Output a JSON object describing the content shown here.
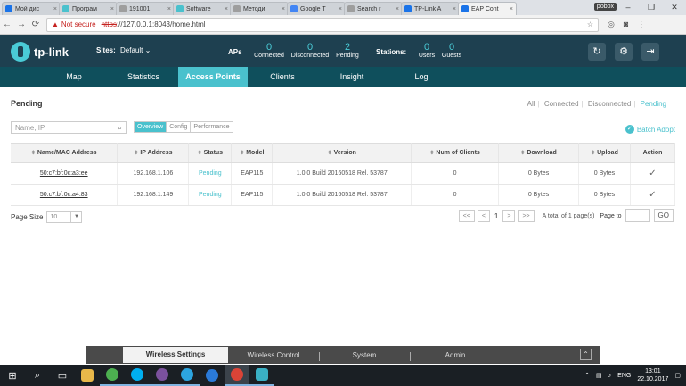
{
  "browser": {
    "tabs": [
      {
        "title": "Мой дис",
        "color": "#1a73e8",
        "active": false
      },
      {
        "title": "Програм",
        "color": "#4ac1cd",
        "active": false
      },
      {
        "title": "191001",
        "color": "#9e9e9e",
        "active": false
      },
      {
        "title": "Software",
        "color": "#4ac1cd",
        "active": false
      },
      {
        "title": "Методи",
        "color": "#9e9e9e",
        "active": false
      },
      {
        "title": "Google T",
        "color": "#4285f4",
        "active": false
      },
      {
        "title": "Search r",
        "color": "#9e9e9e",
        "active": false
      },
      {
        "title": "TP-Link A",
        "color": "#1a73e8",
        "active": false
      },
      {
        "title": "EAP Cont",
        "color": "#1a73e8",
        "active": true
      }
    ],
    "profile": "pobox",
    "not_secure": "Not secure",
    "url_host": "https",
    "url_rest": "://127.0.0.1:8043/home.html"
  },
  "header": {
    "logo": "tp-link",
    "sites_label": "Sites:",
    "sites_value": "Default",
    "aps_label": "APs",
    "aps": [
      {
        "num": "0",
        "label": "Connected"
      },
      {
        "num": "0",
        "label": "Disconnected"
      },
      {
        "num": "2",
        "label": "Pending"
      }
    ],
    "stations_label": "Stations:",
    "stations": [
      {
        "num": "0",
        "label": "Users"
      },
      {
        "num": "0",
        "label": "Guests"
      }
    ]
  },
  "nav": {
    "items": [
      "Map",
      "Statistics",
      "Access Points",
      "Clients",
      "Insight",
      "Log"
    ],
    "active": "Access Points"
  },
  "content": {
    "title": "Pending",
    "filters": {
      "all": "All",
      "connected": "Connected",
      "disconnected": "Disconnected",
      "pending": "Pending"
    },
    "search_placeholder": "Name, IP",
    "views": {
      "overview": "Overview",
      "config": "Config",
      "performance": "Performance"
    },
    "batch_adopt": "Batch Adopt",
    "columns": [
      "Name/MAC Address",
      "IP Address",
      "Status",
      "Model",
      "Version",
      "Num of Clients",
      "Download",
      "Upload",
      "Action"
    ],
    "rows": [
      {
        "mac": "50:c7:bf:0c:a3:ee",
        "ip": "192.168.1.106",
        "status": "Pending",
        "model": "EAP115",
        "version": "1.0.0 Build 20160518 Rel. 53787",
        "clients": "0",
        "download": "0 Bytes",
        "upload": "0 Bytes",
        "action": "✓"
      },
      {
        "mac": "50:c7:bf:0c:a4:83",
        "ip": "192.168.1.149",
        "status": "Pending",
        "model": "EAP115",
        "version": "1.0.0 Build 20160518 Rel. 53787",
        "clients": "0",
        "download": "0 Bytes",
        "upload": "0 Bytes",
        "action": "✓"
      }
    ],
    "page_size_label": "Page Size",
    "page_size_value": "10",
    "pager": {
      "first": "<<",
      "prev": "<",
      "current": "1",
      "next": ">",
      "last": ">>",
      "info": "A total of 1 page(s)",
      "page_to": "Page to",
      "go": "GO"
    }
  },
  "bottom_panel": {
    "tabs": [
      "Wireless Settings",
      "Wireless Control",
      "System",
      "Admin"
    ],
    "active": "Wireless Settings"
  },
  "taskbar": {
    "lang": "ENG",
    "time": "13:01",
    "date": "22.10.2017"
  }
}
